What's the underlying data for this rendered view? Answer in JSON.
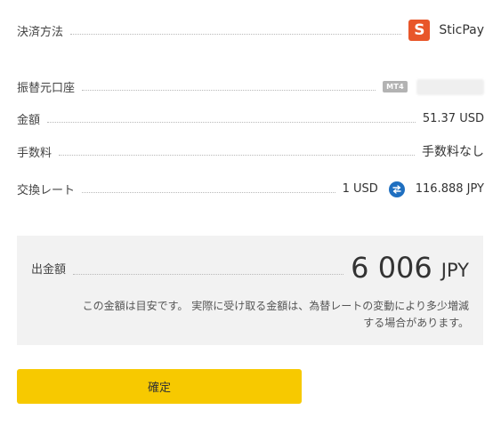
{
  "payment_method": {
    "label": "決済方法",
    "logo_letter": "S",
    "value": "SticPay",
    "logo_color": "#e8562a"
  },
  "source_account": {
    "label": "振替元口座",
    "badge": "MT4"
  },
  "amount": {
    "label": "金額",
    "value": "51.37 USD"
  },
  "fee": {
    "label": "手数料",
    "value": "手数料なし"
  },
  "exchange_rate": {
    "label": "交換レート",
    "from": "1 USD",
    "to": "116.888 JPY",
    "icon": "swap-icon",
    "icon_color": "#1f6fc0"
  },
  "withdrawal": {
    "label": "出金額",
    "amount": "6 006",
    "currency": "JPY",
    "note": "この金額は目安です。 実際に受け取る金額は、為替レートの変動により多少増減する場合があります。"
  },
  "confirm_button": {
    "label": "確定",
    "color": "#f7c900"
  }
}
